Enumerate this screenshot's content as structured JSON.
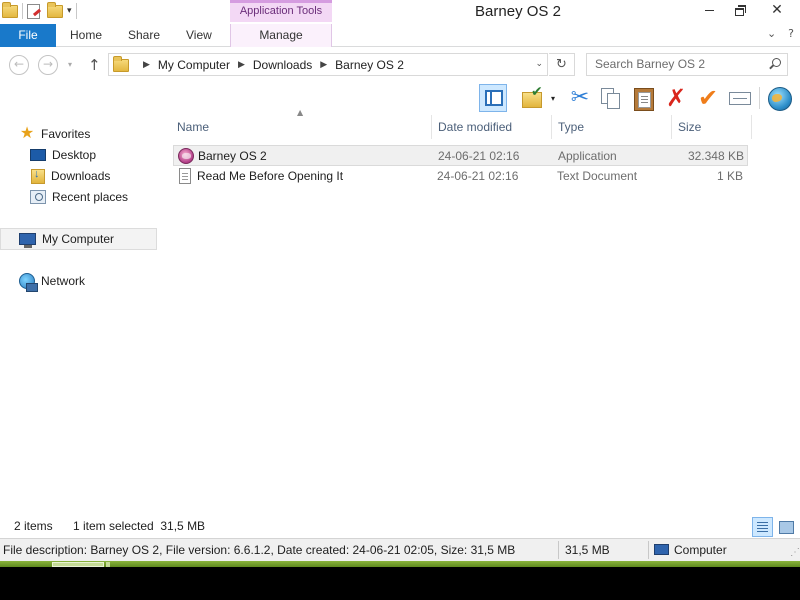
{
  "window": {
    "title": "Barney OS 2",
    "contextual_tab_group": "Application Tools",
    "close_glyph": "✕"
  },
  "ribbon": {
    "tabs": [
      "File",
      "Home",
      "Share",
      "View",
      "Manage"
    ],
    "right_glyphs": [
      "⌄",
      "?"
    ],
    "accent": "#1979ca",
    "contextual_color": "#f3d8f5"
  },
  "address": {
    "crumbs": [
      "My Computer",
      "Downloads",
      "Barney OS 2"
    ],
    "crumb_sep": "▶",
    "dropdown_glyph": "⌄",
    "refresh_glyph": "↻",
    "back_glyph": "←",
    "forward_glyph": "→",
    "history_glyph": "▾",
    "up_glyph": "↑",
    "search_placeholder": "Search Barney OS 2"
  },
  "toolbar": {
    "icons": [
      "preview-pane-icon",
      "new-folder-icon",
      "cut-icon",
      "copy-icon",
      "paste-icon",
      "delete-icon",
      "properties-check-icon",
      "rename-icon",
      "web-globe-icon"
    ],
    "dd_glyph": "▾",
    "cut_glyph": "✂",
    "delete_glyph": "✗",
    "check_glyph": "✔"
  },
  "nav": {
    "favorites": {
      "label": "Favorites",
      "glyph": "★"
    },
    "items": [
      {
        "label": "Desktop",
        "icon": "desktop-icon"
      },
      {
        "label": "Downloads",
        "icon": "downloads-folder-icon"
      },
      {
        "label": "Recent places",
        "icon": "recent-places-icon"
      }
    ],
    "computer": "My Computer",
    "network": "Network"
  },
  "columns": [
    "Name",
    "Date modified",
    "Type",
    "Size"
  ],
  "sort_glyph": "▲",
  "files": [
    {
      "name": "Barney OS 2",
      "date": "24-06-21 02:16",
      "type": "Application",
      "size": "32.348 KB",
      "icon": "application-icon",
      "selected": true
    },
    {
      "name": "Read Me Before Opening It",
      "date": "24-06-21 02:16",
      "type": "Text Document",
      "size": "1 KB",
      "icon": "text-document-icon",
      "selected": false
    }
  ],
  "status": {
    "item_count": "2 items",
    "selection": "1 item selected  31,5 MB",
    "description": "File description: Barney OS 2, File version: 6.6.1.2, Date created: 24-06-21 02:05, Size: 31,5 MB",
    "size": "31,5 MB",
    "location": "Computer",
    "grip_glyph": "⋰"
  }
}
